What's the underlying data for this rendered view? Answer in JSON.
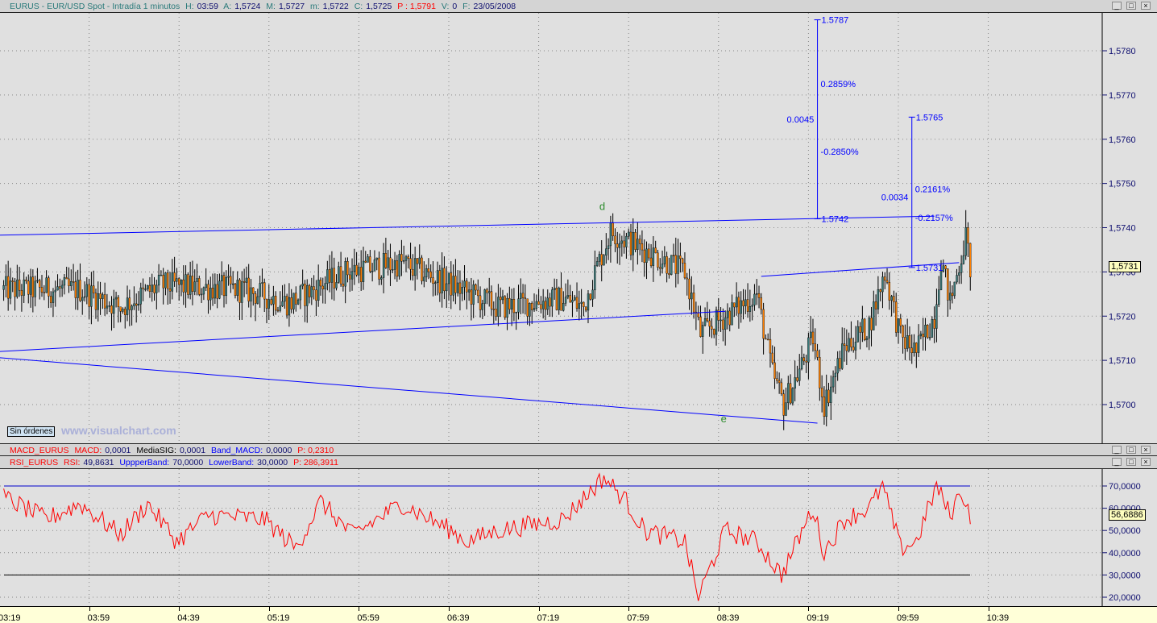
{
  "header": {
    "symbol": "EURUS - EUR/USD Spot - Intradía 1 minutos",
    "h_label": "H:",
    "h": "03:59",
    "a_label": "A:",
    "a": "1,5724",
    "m_label": "M:",
    "m": "1,5727",
    "lo_label": "m:",
    "lo": "1,5722",
    "c_label": "C:",
    "c": "1,5725",
    "p_label": "P : 1,5791",
    "v_label": "V:",
    "v": "0",
    "f_label": "F:",
    "f": "23/05/2008"
  },
  "window_buttons": [
    "minimize",
    "maximize",
    "close"
  ],
  "macd": {
    "name": "MACD_EURUS",
    "macd_label": "MACD:",
    "macd": "0,0001",
    "sig_label": "MediaSIG:",
    "sig": "0,0001",
    "band_label": "Band_MACD:",
    "band": "0,0000",
    "p": "P: 0,2310"
  },
  "rsi": {
    "name": "RSI_EURUS",
    "rsi_label": "RSI:",
    "rsi": "49,8631",
    "upper_label": "UppperBand:",
    "upper": "70,0000",
    "lower_label": "LowerBand:",
    "lower": "30,0000",
    "p": "P: 286,3911",
    "current": "56,6886"
  },
  "orders_label": "Sin órdenes",
  "watermark": "www.visualchart.com",
  "colors": {
    "bull": "#3a7a7a",
    "bear": "#ff8000",
    "lines": "#0000ff",
    "rsi": "#ff0000",
    "axis_text": "#101070"
  },
  "chart_data": [
    {
      "type": "candlestick",
      "title": "EURUS",
      "timeframe": "1 minute",
      "date": "23/05/2008",
      "y_ticks": [
        "1,5700",
        "1,5710",
        "1,5720",
        "1,5730",
        "1,5740",
        "1,5750",
        "1,5760",
        "1,5770",
        "1,5780"
      ],
      "ylim": [
        1.5692,
        1.5794
      ],
      "current_price": "1,5731",
      "x_ticks": [
        "03:19",
        "03:59",
        "04:39",
        "05:19",
        "05:59",
        "06:39",
        "07:19",
        "07:59",
        "08:39",
        "09:19",
        "09:59",
        "10:39"
      ],
      "approx_close_path": [
        [
          "03:21",
          1.5726
        ],
        [
          "03:55",
          1.5726
        ],
        [
          "04:13",
          1.5722
        ],
        [
          "04:31",
          1.5727
        ],
        [
          "05:07",
          1.5726
        ],
        [
          "05:28",
          1.5723
        ],
        [
          "05:53",
          1.573
        ],
        [
          "06:18",
          1.5732
        ],
        [
          "06:40",
          1.5727
        ],
        [
          "07:01",
          1.5722
        ],
        [
          "07:30",
          1.5724
        ],
        [
          "07:39",
          1.5722
        ],
        [
          "07:44",
          1.573
        ],
        [
          "07:51",
          1.5739
        ],
        [
          "08:06",
          1.5735
        ],
        [
          "08:24",
          1.573
        ],
        [
          "08:31",
          1.5716
        ],
        [
          "08:42",
          1.572
        ],
        [
          "08:56",
          1.5725
        ],
        [
          "09:03",
          1.5707
        ],
        [
          "09:08",
          1.57
        ],
        [
          "09:17",
          1.571
        ],
        [
          "09:21",
          1.5715
        ],
        [
          "09:26",
          1.57
        ],
        [
          "09:35",
          1.5713
        ],
        [
          "09:46",
          1.5718
        ],
        [
          "09:53",
          1.573
        ],
        [
          "10:00",
          1.5715
        ],
        [
          "10:07",
          1.5712
        ],
        [
          "10:15",
          1.572
        ],
        [
          "10:18",
          1.5733
        ],
        [
          "10:22",
          1.5723
        ],
        [
          "10:29",
          1.5738
        ],
        [
          "10:31",
          1.5731
        ]
      ],
      "trendlines": [
        [
          [
            "03:19",
            1.57383
          ],
          [
            "10:15",
            1.57426
          ]
        ],
        [
          [
            "03:19",
            1.5712
          ],
          [
            "08:42",
            1.57211
          ]
        ],
        [
          [
            "08:58",
            1.5729
          ],
          [
            "10:26",
            1.57321
          ]
        ],
        [
          [
            "03:19",
            1.57106
          ],
          [
            "09:23",
            1.56958
          ]
        ]
      ],
      "labels": [
        {
          "text": "d",
          "time": "07:46",
          "price": 1.5744
        },
        {
          "text": "e",
          "time": "08:40",
          "price": 1.5696
        }
      ],
      "measures": [
        {
          "time": "09:23",
          "from": "1.5742",
          "to": "1.5787",
          "diff": "0.0045",
          "up_pct": "0.2859%",
          "down_pct": "-0.2850%"
        },
        {
          "time": "10:05",
          "from": "1.5731",
          "to": "1.5765",
          "diff": "0.0034",
          "up_pct": "0.2161%",
          "down_pct": "-0.2157%"
        }
      ]
    },
    {
      "type": "line",
      "title": "RSI_EURUS",
      "y_ticks": [
        "20,0000",
        "30,0000",
        "40,0000",
        "50,0000",
        "60,0000",
        "70,0000"
      ],
      "ylim": [
        16,
        78
      ],
      "bands": [
        70,
        30
      ],
      "approx_path": [
        [
          "03:21",
          65
        ],
        [
          "03:40",
          55
        ],
        [
          "03:55",
          62
        ],
        [
          "04:13",
          48
        ],
        [
          "04:25",
          62
        ],
        [
          "04:38",
          45
        ],
        [
          "04:52",
          57
        ],
        [
          "05:17",
          55
        ],
        [
          "05:31",
          42
        ],
        [
          "05:42",
          63
        ],
        [
          "05:56",
          48
        ],
        [
          "06:18",
          62
        ],
        [
          "06:40",
          50
        ],
        [
          "06:47",
          45
        ],
        [
          "07:01",
          50
        ],
        [
          "07:30",
          55
        ],
        [
          "07:48",
          74
        ],
        [
          "07:58",
          63
        ],
        [
          "08:06",
          50
        ],
        [
          "08:24",
          45
        ],
        [
          "08:30",
          20
        ],
        [
          "08:42",
          50
        ],
        [
          "08:56",
          45
        ],
        [
          "09:07",
          30
        ],
        [
          "09:21",
          60
        ],
        [
          "09:26",
          40
        ],
        [
          "09:35",
          55
        ],
        [
          "09:46",
          60
        ],
        [
          "09:52",
          70
        ],
        [
          "10:00",
          42
        ],
        [
          "10:07",
          45
        ],
        [
          "10:16",
          70
        ],
        [
          "10:22",
          57
        ],
        [
          "10:27",
          68
        ],
        [
          "10:31",
          57
        ]
      ]
    }
  ]
}
